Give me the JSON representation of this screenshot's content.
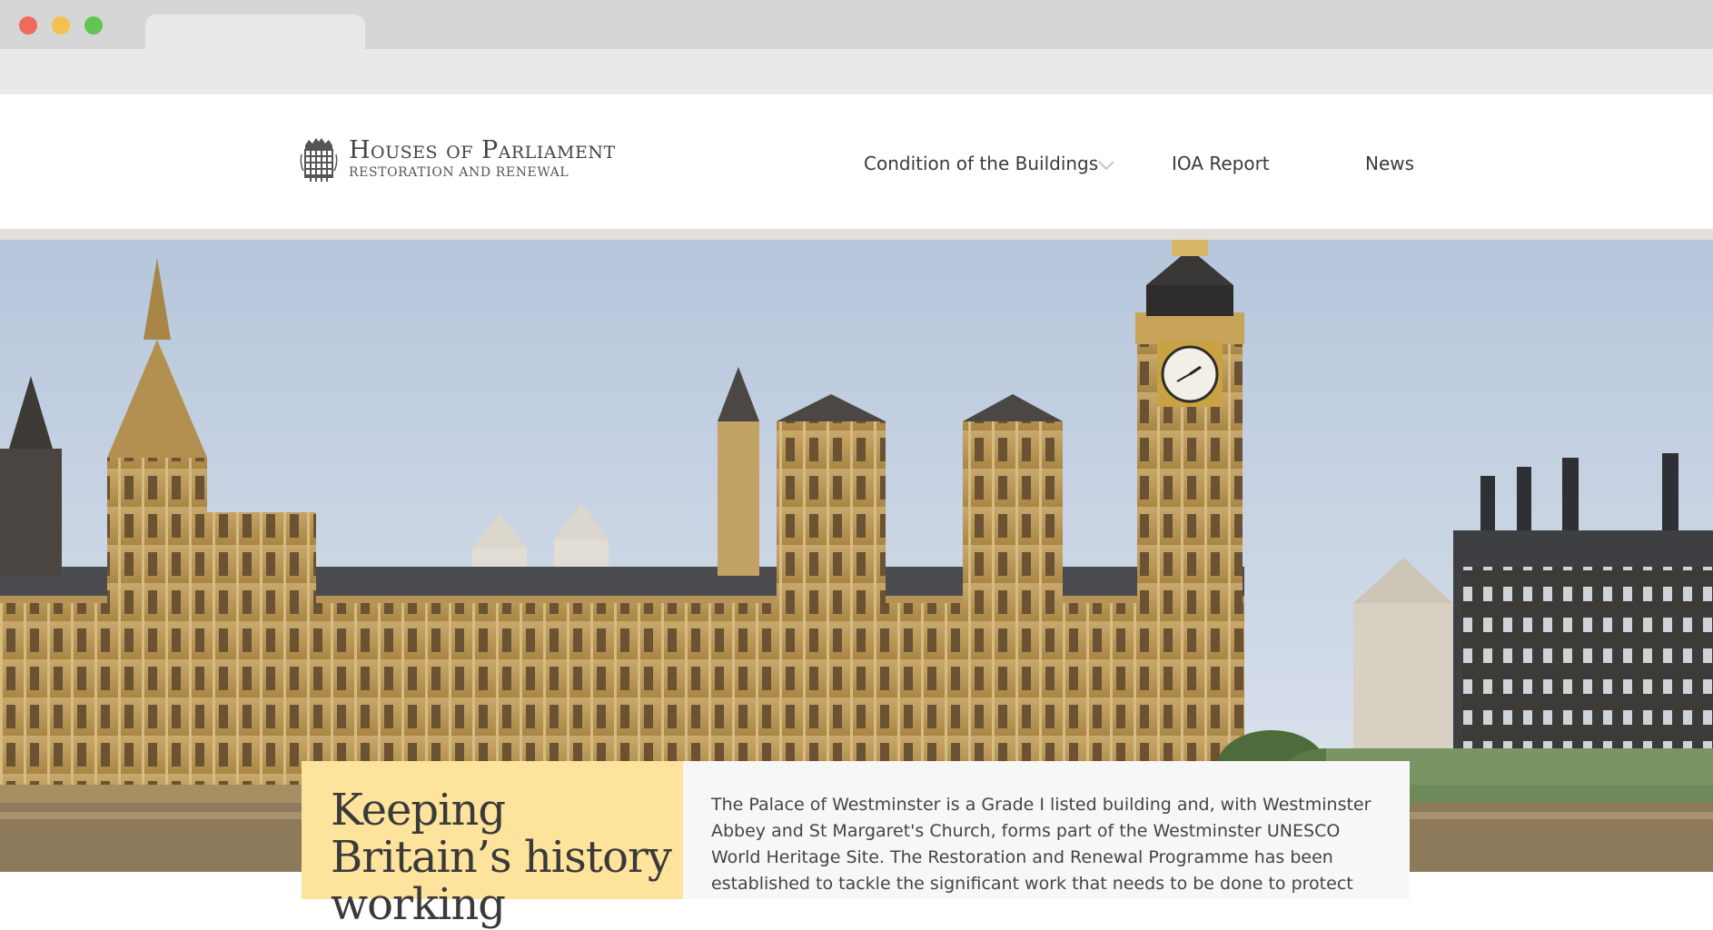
{
  "browser": {
    "traffic_lights": [
      "close",
      "minimize",
      "maximize"
    ],
    "colors": {
      "close": "#ee6a5e",
      "minimize": "#f5c04f",
      "maximize": "#61c554"
    }
  },
  "site": {
    "logo": {
      "title": "Houses of Parliament",
      "subtitle": "Restoration and Renewal",
      "icon": "portcullis-icon"
    },
    "nav": [
      {
        "label": "Condition of the Buildings",
        "has_dropdown": true
      },
      {
        "label": "IOA Report"
      },
      {
        "label": "News"
      }
    ]
  },
  "hero": {
    "image": "palace-of-westminster-photo",
    "card": {
      "title": "Keeping Britain’s history working",
      "body": "The Palace of Westminster is a Grade I listed building and, with Westminster Abbey and St Margaret's Church, forms part of the Westminster UNESCO World Heritage Site. The Restoration and Renewal Programme has been established to tackle the significant work that needs to be done to protect",
      "accent_color": "#fde39b"
    }
  }
}
